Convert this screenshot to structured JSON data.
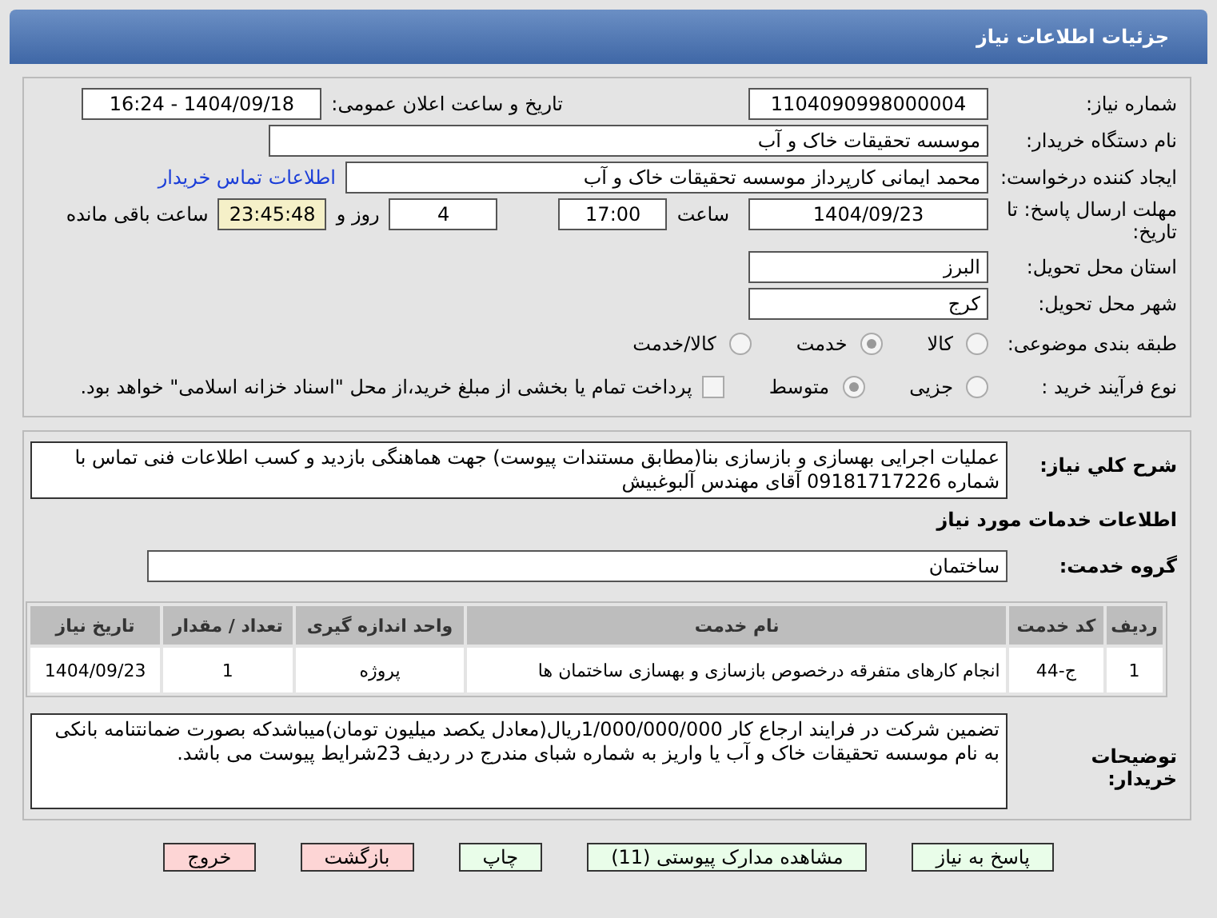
{
  "header": {
    "title": "جزئیات اطلاعات نیاز"
  },
  "need_number": {
    "label": "شماره نیاز:",
    "value": "1104090998000004"
  },
  "announce": {
    "label": "تاریخ و ساعت اعلان عمومی:",
    "value": "1404/09/18 - 16:24"
  },
  "buyer_org": {
    "label": "نام دستگاه خریدار:",
    "value": "موسسه تحقیقات خاک و آب"
  },
  "requester": {
    "label": "ایجاد کننده درخواست:",
    "value": "محمد ایمانی کارپرداز موسسه تحقیقات خاک و آب",
    "link": "اطلاعات تماس خریدار"
  },
  "deadline": {
    "label": "مهلت ارسال پاسخ: تا تاریخ:",
    "date": "1404/09/23",
    "time_label": "ساعت",
    "time": "17:00",
    "days": "4",
    "days_label": "روز و",
    "remaining": "23:45:48",
    "remaining_label": "ساعت باقی مانده"
  },
  "province": {
    "label": "استان محل تحویل:",
    "value": "البرز"
  },
  "city": {
    "label": "شهر محل تحویل:",
    "value": "کرج"
  },
  "category": {
    "label": "طبقه بندی موضوعی:",
    "options": [
      {
        "label": "کالا",
        "selected": false
      },
      {
        "label": "خدمت",
        "selected": true
      },
      {
        "label": "کالا/خدمت",
        "selected": false
      }
    ]
  },
  "process": {
    "label": "نوع فرآیند خرید :",
    "options": [
      {
        "label": "جزیی",
        "selected": false
      },
      {
        "label": "متوسط",
        "selected": true
      }
    ],
    "payment": {
      "checked": false,
      "text": "پرداخت تمام یا بخشی از مبلغ خرید،از محل \"اسناد خزانه اسلامی\" خواهد بود."
    }
  },
  "description": {
    "label": "شرح کلي نياز:",
    "value": "عملیات اجرایی بهسازی و بازسازی بنا(مطابق مستندات پیوست) جهت هماهنگی بازدید و کسب اطلاعات فنی تماس با شماره 09181717226 آقای مهندس آلبوغبیش"
  },
  "services_heading": "اطلاعات خدمات مورد نیاز",
  "service_group": {
    "label": "گروه خدمت:",
    "value": "ساختمان"
  },
  "table": {
    "columns": [
      "ردیف",
      "کد خدمت",
      "نام خدمت",
      "واحد اندازه گیری",
      "تعداد / مقدار",
      "تاریخ نیاز"
    ],
    "rows": [
      [
        "1",
        "ج-44",
        "انجام کارهای متفرقه درخصوص بازسازی و بهسازی ساختمان ها",
        "پروژه",
        "1",
        "1404/09/23"
      ]
    ]
  },
  "buyer_notes": {
    "label": "توضیحات خریدار:",
    "value": "تضمین شرکت در فرایند ارجاع کار 1/000/000/000ریال(معادل یکصد میلیون تومان)میباشدکه بصورت ضمانتنامه بانکی به نام موسسه تحقیقات خاک و آب یا واریز به شماره شبای مندرج در ردیف 23شرایط پیوست می باشد."
  },
  "buttons": [
    {
      "label": "پاسخ به نیاز",
      "kind": "normal"
    },
    {
      "label": "مشاهده مدارک پیوستی (11)",
      "kind": "normal"
    },
    {
      "label": "چاپ",
      "kind": "normal"
    },
    {
      "label": "بازگشت",
      "kind": "danger"
    },
    {
      "label": "خروج",
      "kind": "danger"
    }
  ]
}
